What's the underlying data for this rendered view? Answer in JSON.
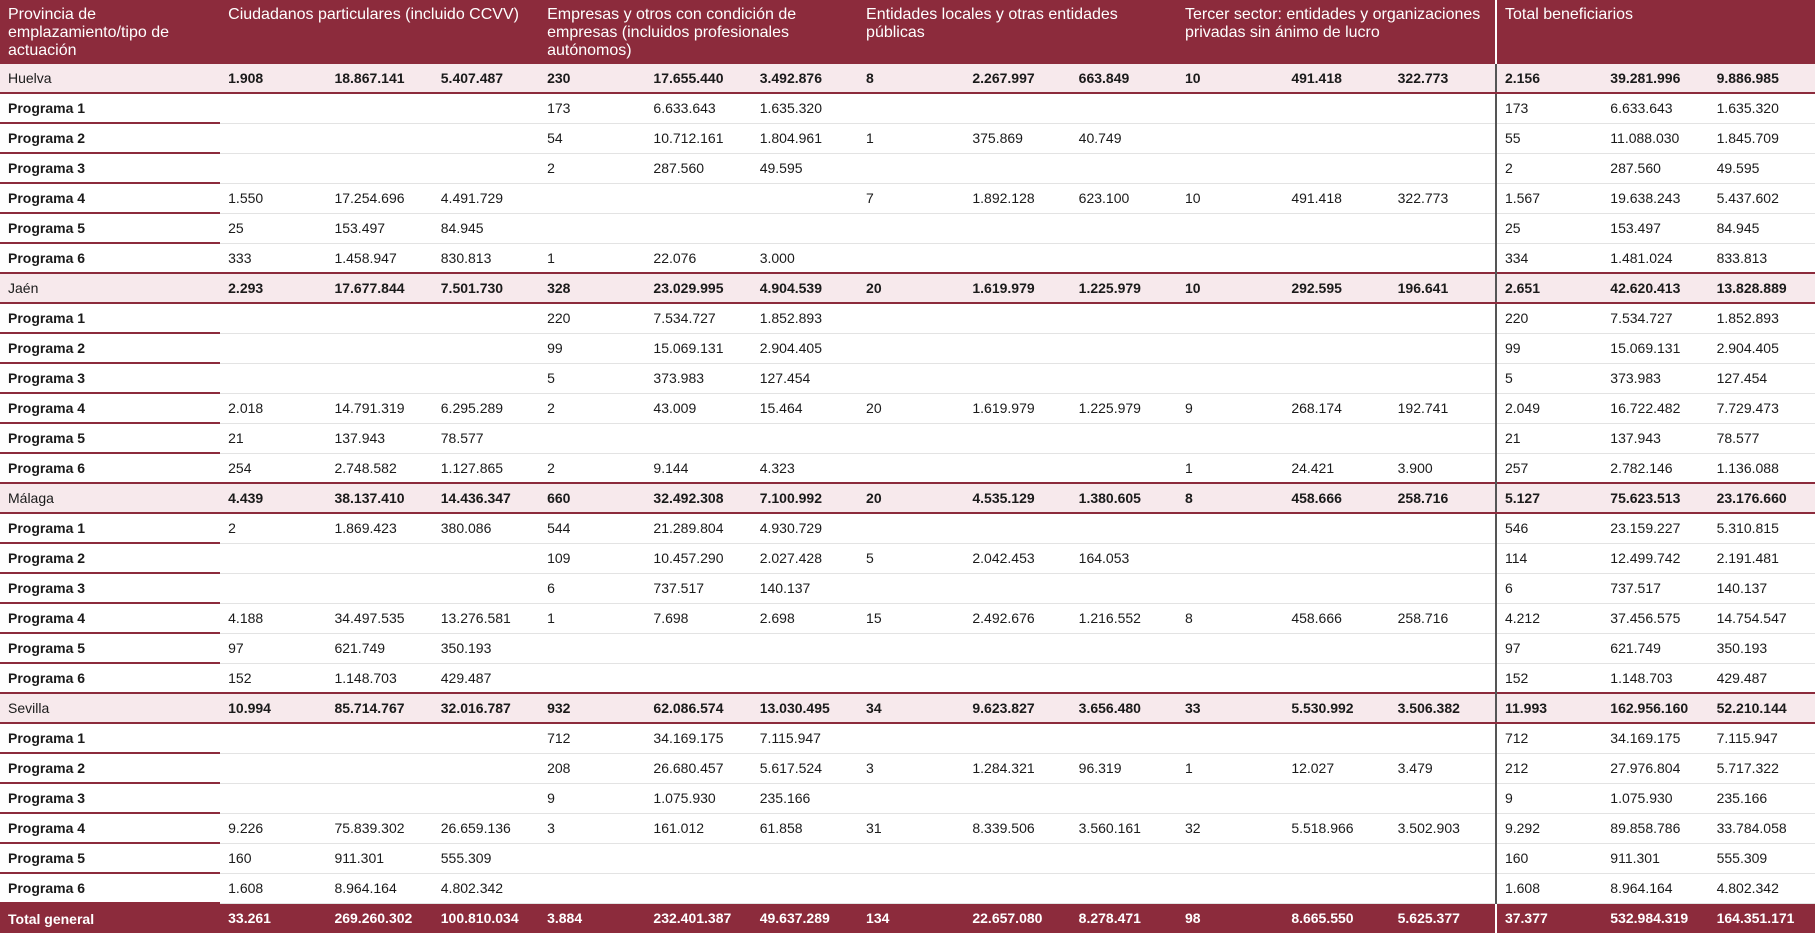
{
  "header": {
    "col_province": "Provincia de emplazamiento/tipo de actuación",
    "col_groups": [
      "Ciudadanos particulares (incluido CCVV)",
      "Empresas y otros con condición de empresas (incluidos profesionales autónomos)",
      "Entidades locales y otras entidades públicas",
      "Tercer sector: entidades y organizaciones privadas sin ánimo de lucro",
      "Total beneficiarios"
    ]
  },
  "rows": [
    {
      "type": "province",
      "label": "Huelva",
      "cells": [
        "1.908",
        "18.867.141",
        "5.407.487",
        "230",
        "17.655.440",
        "3.492.876",
        "8",
        "2.267.997",
        "663.849",
        "10",
        "491.418",
        "322.773",
        "2.156",
        "39.281.996",
        "9.886.985"
      ]
    },
    {
      "type": "program",
      "label": "Programa 1",
      "cells": [
        "",
        "",
        "",
        "173",
        "6.633.643",
        "1.635.320",
        "",
        "",
        "",
        "",
        "",
        "",
        "173",
        "6.633.643",
        "1.635.320"
      ]
    },
    {
      "type": "program",
      "label": "Programa 2",
      "cells": [
        "",
        "",
        "",
        "54",
        "10.712.161",
        "1.804.961",
        "1",
        "375.869",
        "40.749",
        "",
        "",
        "",
        "55",
        "11.088.030",
        "1.845.709"
      ]
    },
    {
      "type": "program",
      "label": "Programa 3",
      "cells": [
        "",
        "",
        "",
        "2",
        "287.560",
        "49.595",
        "",
        "",
        "",
        "",
        "",
        "",
        "2",
        "287.560",
        "49.595"
      ]
    },
    {
      "type": "program",
      "label": "Programa 4",
      "cells": [
        "1.550",
        "17.254.696",
        "4.491.729",
        "",
        "",
        "",
        "7",
        "1.892.128",
        "623.100",
        "10",
        "491.418",
        "322.773",
        "1.567",
        "19.638.243",
        "5.437.602"
      ]
    },
    {
      "type": "program",
      "label": "Programa 5",
      "cells": [
        "25",
        "153.497",
        "84.945",
        "",
        "",
        "",
        "",
        "",
        "",
        "",
        "",
        "",
        "25",
        "153.497",
        "84.945"
      ]
    },
    {
      "type": "program",
      "label": "Programa 6",
      "cells": [
        "333",
        "1.458.947",
        "830.813",
        "1",
        "22.076",
        "3.000",
        "",
        "",
        "",
        "",
        "",
        "",
        "334",
        "1.481.024",
        "833.813"
      ]
    },
    {
      "type": "province",
      "label": "Jaén",
      "cells": [
        "2.293",
        "17.677.844",
        "7.501.730",
        "328",
        "23.029.995",
        "4.904.539",
        "20",
        "1.619.979",
        "1.225.979",
        "10",
        "292.595",
        "196.641",
        "2.651",
        "42.620.413",
        "13.828.889"
      ]
    },
    {
      "type": "program",
      "label": "Programa 1",
      "cells": [
        "",
        "",
        "",
        "220",
        "7.534.727",
        "1.852.893",
        "",
        "",
        "",
        "",
        "",
        "",
        "220",
        "7.534.727",
        "1.852.893"
      ]
    },
    {
      "type": "program",
      "label": "Programa 2",
      "cells": [
        "",
        "",
        "",
        "99",
        "15.069.131",
        "2.904.405",
        "",
        "",
        "",
        "",
        "",
        "",
        "99",
        "15.069.131",
        "2.904.405"
      ]
    },
    {
      "type": "program",
      "label": "Programa 3",
      "cells": [
        "",
        "",
        "",
        "5",
        "373.983",
        "127.454",
        "",
        "",
        "",
        "",
        "",
        "",
        "5",
        "373.983",
        "127.454"
      ]
    },
    {
      "type": "program",
      "label": "Programa 4",
      "cells": [
        "2.018",
        "14.791.319",
        "6.295.289",
        "2",
        "43.009",
        "15.464",
        "20",
        "1.619.979",
        "1.225.979",
        "9",
        "268.174",
        "192.741",
        "2.049",
        "16.722.482",
        "7.729.473"
      ]
    },
    {
      "type": "program",
      "label": "Programa 5",
      "cells": [
        "21",
        "137.943",
        "78.577",
        "",
        "",
        "",
        "",
        "",
        "",
        "",
        "",
        "",
        "21",
        "137.943",
        "78.577"
      ]
    },
    {
      "type": "program",
      "label": "Programa 6",
      "cells": [
        "254",
        "2.748.582",
        "1.127.865",
        "2",
        "9.144",
        "4.323",
        "",
        "",
        "",
        "1",
        "24.421",
        "3.900",
        "257",
        "2.782.146",
        "1.136.088"
      ]
    },
    {
      "type": "province",
      "label": "Málaga",
      "cells": [
        "4.439",
        "38.137.410",
        "14.436.347",
        "660",
        "32.492.308",
        "7.100.992",
        "20",
        "4.535.129",
        "1.380.605",
        "8",
        "458.666",
        "258.716",
        "5.127",
        "75.623.513",
        "23.176.660"
      ]
    },
    {
      "type": "program",
      "label": "Programa 1",
      "cells": [
        "2",
        "1.869.423",
        "380.086",
        "544",
        "21.289.804",
        "4.930.729",
        "",
        "",
        "",
        "",
        "",
        "",
        "546",
        "23.159.227",
        "5.310.815"
      ]
    },
    {
      "type": "program",
      "label": "Programa 2",
      "cells": [
        "",
        "",
        "",
        "109",
        "10.457.290",
        "2.027.428",
        "5",
        "2.042.453",
        "164.053",
        "",
        "",
        "",
        "114",
        "12.499.742",
        "2.191.481"
      ]
    },
    {
      "type": "program",
      "label": "Programa 3",
      "cells": [
        "",
        "",
        "",
        "6",
        "737.517",
        "140.137",
        "",
        "",
        "",
        "",
        "",
        "",
        "6",
        "737.517",
        "140.137"
      ]
    },
    {
      "type": "program",
      "label": "Programa 4",
      "cells": [
        "4.188",
        "34.497.535",
        "13.276.581",
        "1",
        "7.698",
        "2.698",
        "15",
        "2.492.676",
        "1.216.552",
        "8",
        "458.666",
        "258.716",
        "4.212",
        "37.456.575",
        "14.754.547"
      ]
    },
    {
      "type": "program",
      "label": "Programa 5",
      "cells": [
        "97",
        "621.749",
        "350.193",
        "",
        "",
        "",
        "",
        "",
        "",
        "",
        "",
        "",
        "97",
        "621.749",
        "350.193"
      ]
    },
    {
      "type": "program",
      "label": "Programa 6",
      "cells": [
        "152",
        "1.148.703",
        "429.487",
        "",
        "",
        "",
        "",
        "",
        "",
        "",
        "",
        "",
        "152",
        "1.148.703",
        "429.487"
      ]
    },
    {
      "type": "province",
      "label": "Sevilla",
      "cells": [
        "10.994",
        "85.714.767",
        "32.016.787",
        "932",
        "62.086.574",
        "13.030.495",
        "34",
        "9.623.827",
        "3.656.480",
        "33",
        "5.530.992",
        "3.506.382",
        "11.993",
        "162.956.160",
        "52.210.144"
      ]
    },
    {
      "type": "program",
      "label": "Programa 1",
      "cells": [
        "",
        "",
        "",
        "712",
        "34.169.175",
        "7.115.947",
        "",
        "",
        "",
        "",
        "",
        "",
        "712",
        "34.169.175",
        "7.115.947"
      ]
    },
    {
      "type": "program",
      "label": "Programa 2",
      "cells": [
        "",
        "",
        "",
        "208",
        "26.680.457",
        "5.617.524",
        "3",
        "1.284.321",
        "96.319",
        "1",
        "12.027",
        "3.479",
        "212",
        "27.976.804",
        "5.717.322"
      ]
    },
    {
      "type": "program",
      "label": "Programa 3",
      "cells": [
        "",
        "",
        "",
        "9",
        "1.075.930",
        "235.166",
        "",
        "",
        "",
        "",
        "",
        "",
        "9",
        "1.075.930",
        "235.166"
      ]
    },
    {
      "type": "program",
      "label": "Programa 4",
      "cells": [
        "9.226",
        "75.839.302",
        "26.659.136",
        "3",
        "161.012",
        "61.858",
        "31",
        "8.339.506",
        "3.560.161",
        "32",
        "5.518.966",
        "3.502.903",
        "9.292",
        "89.858.786",
        "33.784.058"
      ]
    },
    {
      "type": "program",
      "label": "Programa 5",
      "cells": [
        "160",
        "911.301",
        "555.309",
        "",
        "",
        "",
        "",
        "",
        "",
        "",
        "",
        "",
        "160",
        "911.301",
        "555.309"
      ]
    },
    {
      "type": "program",
      "label": "Programa 6",
      "cells": [
        "1.608",
        "8.964.164",
        "4.802.342",
        "",
        "",
        "",
        "",
        "",
        "",
        "",
        "",
        "",
        "1.608",
        "8.964.164",
        "4.802.342"
      ]
    },
    {
      "type": "total",
      "label": "Total general",
      "cells": [
        "33.261",
        "269.260.302",
        "100.810.034",
        "3.884",
        "232.401.387",
        "49.637.289",
        "134",
        "22.657.080",
        "8.278.471",
        "98",
        "8.665.550",
        "5.625.377",
        "37.377",
        "532.984.319",
        "164.351.171"
      ]
    }
  ]
}
